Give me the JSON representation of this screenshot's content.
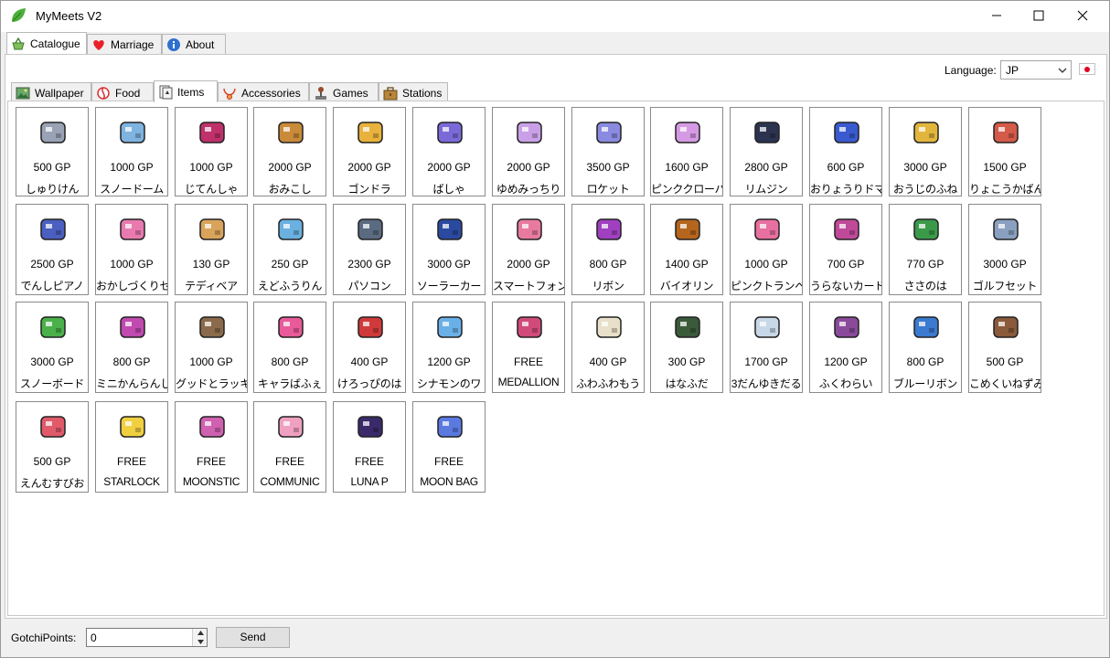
{
  "window": {
    "title": "MyMeets V2",
    "accent": "#4caf3a"
  },
  "main_tabs": [
    {
      "label": "Catalogue",
      "icon": "basket-icon",
      "active": true
    },
    {
      "label": "Marriage",
      "icon": "heart-icon",
      "active": false
    },
    {
      "label": "About",
      "icon": "info-icon",
      "active": false
    }
  ],
  "language": {
    "label": "Language:",
    "value": "JP",
    "flag": "japan-flag-icon"
  },
  "sub_tabs": [
    {
      "label": "Wallpaper",
      "icon": "picture-icon",
      "active": false
    },
    {
      "label": "Food",
      "icon": "candy-icon",
      "active": false
    },
    {
      "label": "Items",
      "icon": "card-icon",
      "active": true
    },
    {
      "label": "Accessories",
      "icon": "necklace-icon",
      "active": false
    },
    {
      "label": "Games",
      "icon": "joystick-icon",
      "active": false
    },
    {
      "label": "Stations",
      "icon": "suitcase-icon",
      "active": false
    }
  ],
  "items": [
    {
      "price": "500 GP",
      "name": "しゅりけん",
      "icon": "shuriken-icon",
      "color": "#9aa3b5"
    },
    {
      "price": "1000 GP",
      "name": "スノードーム",
      "icon": "snow-globe-icon",
      "color": "#7fb3e0"
    },
    {
      "price": "1000 GP",
      "name": "じてんしゃ",
      "icon": "bicycle-icon",
      "color": "#c0306a"
    },
    {
      "price": "2000 GP",
      "name": "おみこし",
      "icon": "mikoshi-icon",
      "color": "#c98a3a"
    },
    {
      "price": "2000 GP",
      "name": "ゴンドラ",
      "icon": "gondola-icon",
      "color": "#e8b23c"
    },
    {
      "price": "2000 GP",
      "name": "ばしゃ",
      "icon": "carriage-icon",
      "color": "#7a6ad8"
    },
    {
      "price": "2000 GP",
      "name": "ゆめみっちり",
      "icon": "dream-car-icon",
      "color": "#c9a0e8"
    },
    {
      "price": "3500 GP",
      "name": "ロケット",
      "icon": "rocket-icon",
      "color": "#8a8ae0"
    },
    {
      "price": "1600 GP",
      "name": "ピンククローバ",
      "icon": "pink-clover-icon",
      "color": "#d59ae3"
    },
    {
      "price": "2800 GP",
      "name": "リムジン",
      "icon": "limousine-icon",
      "color": "#2b3350"
    },
    {
      "price": "600 GP",
      "name": "おりょうりドマ",
      "icon": "cooking-robot-icon",
      "color": "#3a5bd0"
    },
    {
      "price": "3000 GP",
      "name": "おうじのふね",
      "icon": "prince-boat-icon",
      "color": "#e2b63d"
    },
    {
      "price": "1500 GP",
      "name": "りょこうかばん",
      "icon": "travel-bag-icon",
      "color": "#d45a4a"
    },
    {
      "price": "2500 GP",
      "name": "でんしピアノ",
      "icon": "keyboard-icon",
      "color": "#4a5fc0"
    },
    {
      "price": "1000 GP",
      "name": "おかしづくりセ",
      "icon": "oven-icon",
      "color": "#e87ab0"
    },
    {
      "price": "130 GP",
      "name": "テディベア",
      "icon": "teddy-bear-icon",
      "color": "#d8a35a"
    },
    {
      "price": "250 GP",
      "name": "えどふうりん",
      "icon": "wind-chime-icon",
      "color": "#6ab0e0"
    },
    {
      "price": "2300 GP",
      "name": "パソコン",
      "icon": "computer-icon",
      "color": "#5a6a80"
    },
    {
      "price": "3000 GP",
      "name": "ソーラーカー",
      "icon": "solar-car-icon",
      "color": "#2a4aa0"
    },
    {
      "price": "2000 GP",
      "name": "スマートフォン",
      "icon": "smartphone-icon",
      "color": "#e87aa0"
    },
    {
      "price": "800 GP",
      "name": "リボン",
      "icon": "ribbon-icon",
      "color": "#a040c0"
    },
    {
      "price": "1400 GP",
      "name": "バイオリン",
      "icon": "violin-icon",
      "color": "#b5651d"
    },
    {
      "price": "1000 GP",
      "name": "ピンクトランペ",
      "icon": "trumpet-icon",
      "color": "#e870a0"
    },
    {
      "price": "700 GP",
      "name": "うらないカード",
      "icon": "tarot-card-icon",
      "color": "#c04a9a"
    },
    {
      "price": "770 GP",
      "name": "ささのは",
      "icon": "bamboo-icon",
      "color": "#3a9a4a"
    },
    {
      "price": "3000 GP",
      "name": "ゴルフセット",
      "icon": "golf-club-icon",
      "color": "#8aa0c0"
    },
    {
      "price": "3000 GP",
      "name": "スノーボード",
      "icon": "snowboard-icon",
      "color": "#4ab04a"
    },
    {
      "price": "800 GP",
      "name": "ミニかんらんし",
      "icon": "ferris-wheel-icon",
      "color": "#c04ab0"
    },
    {
      "price": "1000 GP",
      "name": "グッドとラッキ",
      "icon": "dogs-icon",
      "color": "#8a6a4a"
    },
    {
      "price": "800 GP",
      "name": "キャラばふぇ",
      "icon": "character-poster-icon",
      "color": "#e85a9a"
    },
    {
      "price": "400 GP",
      "name": "けろっぴのは",
      "icon": "flags-icon",
      "color": "#d03a3a"
    },
    {
      "price": "1200 GP",
      "name": "シナモンのワ",
      "icon": "cinnamon-car-icon",
      "color": "#6ab0e8"
    },
    {
      "price": "FREE",
      "name": "MEDALLION",
      "icon": "medallion-icon",
      "color": "#d04a7a"
    },
    {
      "price": "400 GP",
      "name": "ふわふわもう",
      "icon": "fluffy-blanket-icon",
      "color": "#e8e0c8"
    },
    {
      "price": "300 GP",
      "name": "はなふだ",
      "icon": "hanafuda-icon",
      "color": "#3a5a3a"
    },
    {
      "price": "1700 GP",
      "name": "3だんゆきだる",
      "icon": "snowman-icon",
      "color": "#c8d8e8"
    },
    {
      "price": "1200 GP",
      "name": "ふくわらい",
      "icon": "fukuwarai-icon",
      "color": "#8a4a9a"
    },
    {
      "price": "800 GP",
      "name": "ブルーリボン",
      "icon": "blue-ribbon-tree-icon",
      "color": "#3a7ad0"
    },
    {
      "price": "500 GP",
      "name": "こめくいねずみ",
      "icon": "rice-mouse-icon",
      "color": "#8a5a3a"
    },
    {
      "price": "500 GP",
      "name": "えんむすびお",
      "icon": "omamori-icon",
      "color": "#e05a6a"
    },
    {
      "price": "FREE",
      "name": "STARLOCK",
      "icon": "star-locket-icon",
      "color": "#f0d040"
    },
    {
      "price": "FREE",
      "name": "MOONSTIC",
      "icon": "moon-stick-icon",
      "color": "#d060b0"
    },
    {
      "price": "FREE",
      "name": "COMMUNIC",
      "icon": "communicator-icon",
      "color": "#f0a0c0"
    },
    {
      "price": "FREE",
      "name": "LUNA P",
      "icon": "luna-p-icon",
      "color": "#3a2a6a"
    },
    {
      "price": "FREE",
      "name": "MOON BAG",
      "icon": "moon-bag-icon",
      "color": "#5a7ae0"
    }
  ],
  "footer": {
    "gp_label": "GotchiPoints:",
    "gp_value": "0",
    "send_label": "Send"
  }
}
